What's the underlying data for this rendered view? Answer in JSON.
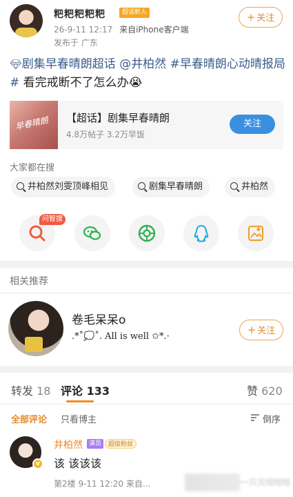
{
  "header": {
    "username": "粑粑粑粑粑",
    "badge": "超话新人",
    "date": "26-9-11 12:17",
    "source_prefix": "来自",
    "source": "iPhone客户端",
    "location": "发布于 广东",
    "follow_label": "关注"
  },
  "post": {
    "topic_link": "剧集早春晴朗超话",
    "mention": "@井柏然",
    "hashtag": "#早春晴朗心动晴报局#",
    "text": " 看完戒断不了怎么办",
    "emoji": "😭"
  },
  "topic_card": {
    "thumb_text": "早春晴朗",
    "title": "【超话】剧集早春晴朗",
    "stats": "4.8万帖子 3.2万早饭",
    "follow_label": "关注"
  },
  "search": {
    "title": "大家都在搜",
    "chips": [
      "井柏然刘雯顶峰相见",
      "剧集早春晴朗",
      "井柏然"
    ]
  },
  "share": {
    "ask_badge": "问智搜",
    "icons": [
      "ask-search-icon",
      "wechat-icon",
      "moments-icon",
      "qq-icon",
      "save-image-icon"
    ]
  },
  "related": {
    "title": "相关推荐",
    "name": "卷毛呆呆o",
    "desc": ".*˚💭˚. All is well ✩*.·",
    "follow_label": "关注"
  },
  "tabs": {
    "repost_label": "转发",
    "repost_count": "18",
    "comment_label": "评论",
    "comment_count": "133",
    "like_label": "赞",
    "like_count": "620"
  },
  "filters": {
    "all": "全部评论",
    "author_only": "只看博主",
    "sort": "倒序"
  },
  "comment": {
    "name": "井柏然",
    "tag1": "演员",
    "tag2": "超级粉丝",
    "text": "该 该该该",
    "meta": "第2楼 9-11 12:20 来自..."
  },
  "watermark": "·一只天晴晴晴",
  "colors": {
    "accent_orange": "#e58a2e",
    "link_blue": "#3b5d8a",
    "follow_blue": "#3a8fe0"
  }
}
